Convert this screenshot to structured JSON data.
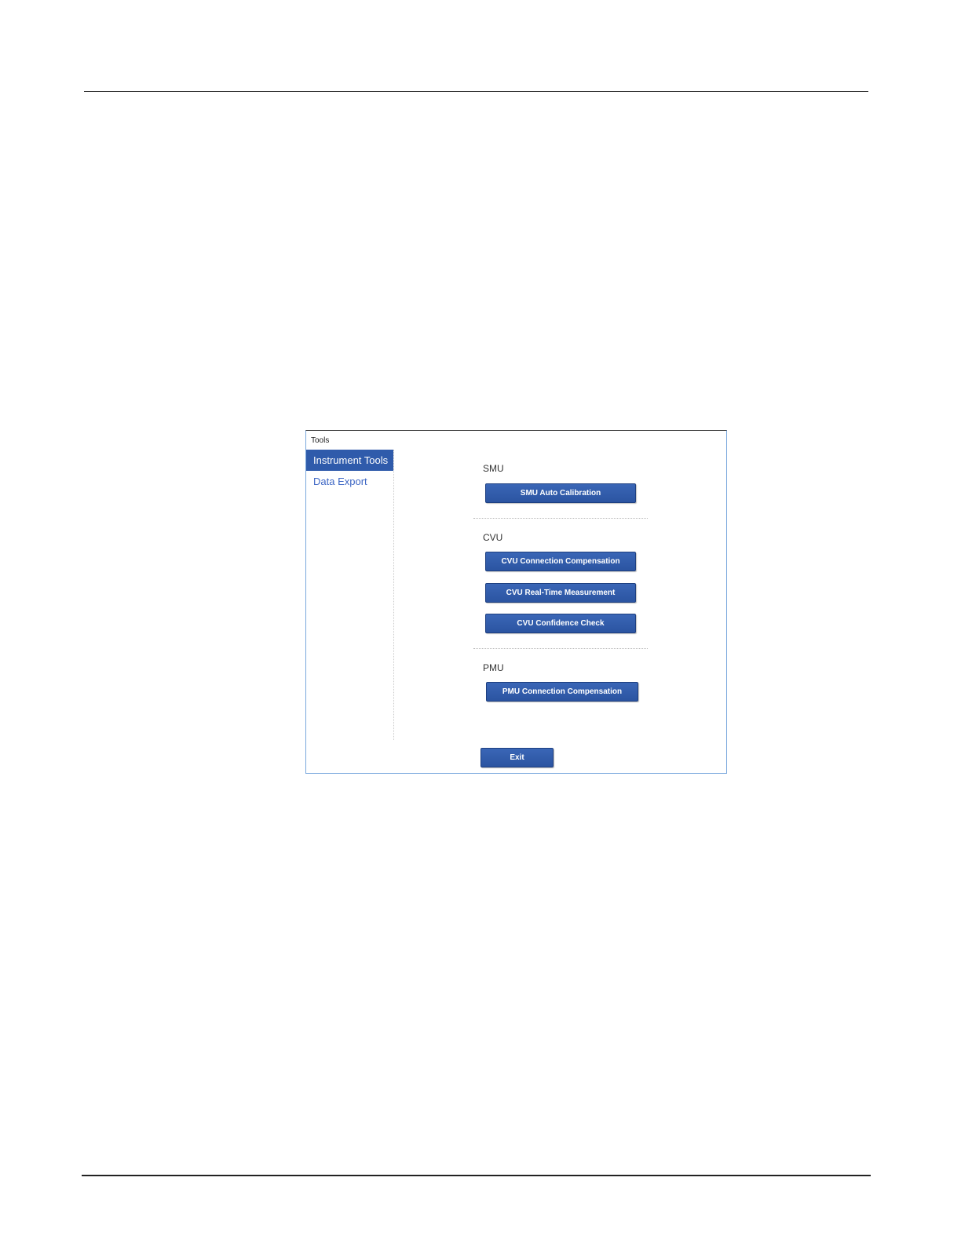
{
  "window": {
    "title": "Tools"
  },
  "sidebar": {
    "items": [
      {
        "label": "Instrument Tools",
        "active": true
      },
      {
        "label": "Data Export",
        "active": false
      }
    ]
  },
  "sections": {
    "smu": {
      "label": "SMU",
      "buttons": [
        "SMU Auto Calibration"
      ]
    },
    "cvu": {
      "label": "CVU",
      "buttons": [
        "CVU Connection Compensation",
        "CVU Real-Time Measurement",
        "CVU Confidence Check"
      ]
    },
    "pmu": {
      "label": "PMU",
      "buttons": [
        "PMU Connection Compensation"
      ]
    }
  },
  "footer": {
    "exit_label": "Exit"
  },
  "colors": {
    "accent": "#2f5bab",
    "sidebar_link": "#3d66c4",
    "window_border": "#7aa7dd"
  }
}
